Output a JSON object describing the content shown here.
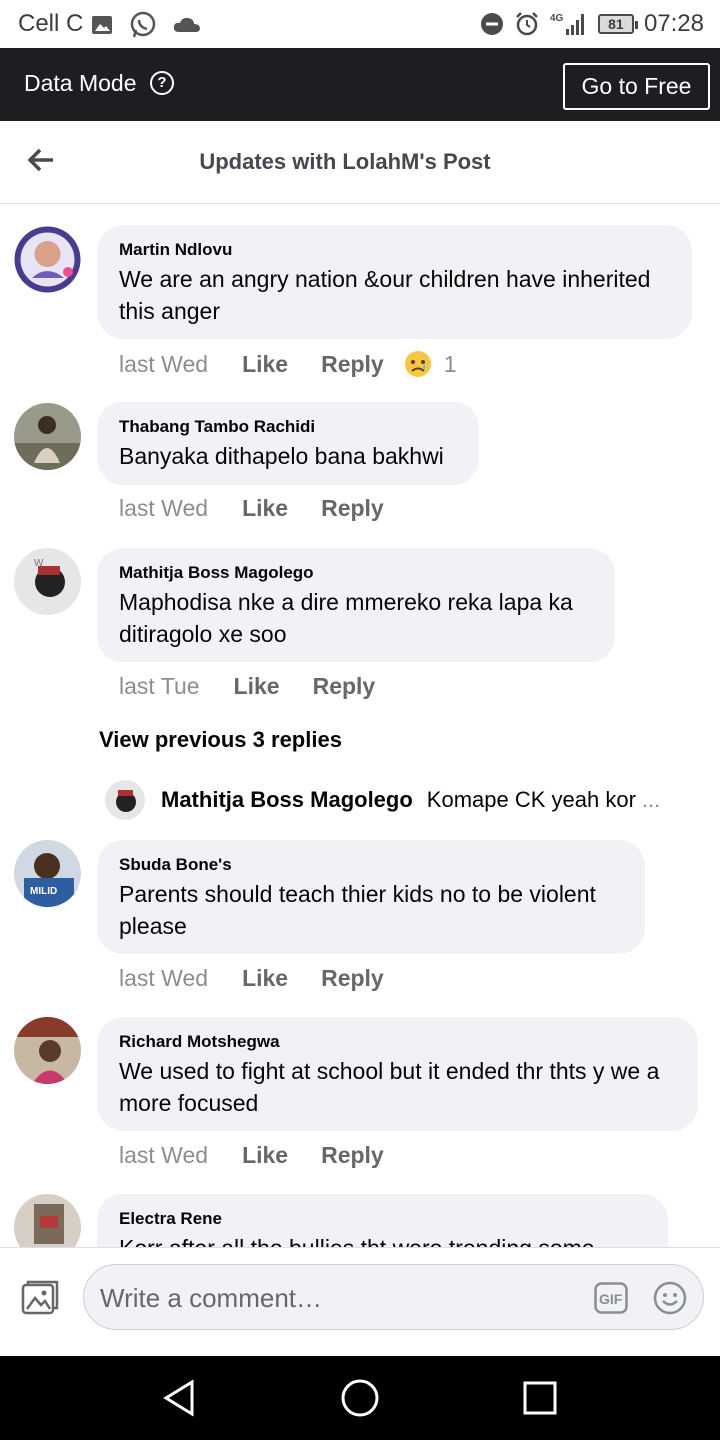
{
  "status_bar": {
    "carrier": "Cell C",
    "network": "4G",
    "battery": "81",
    "time": "07:28"
  },
  "data_mode": {
    "label": "Data Mode",
    "help_icon": "?",
    "button": "Go to Free"
  },
  "header": {
    "title": "Updates with LolahM's Post"
  },
  "comments": [
    {
      "author": "Martin Ndlovu",
      "text": "We are an angry nation &our children have inherited this anger",
      "time": "last Wed",
      "like": "Like",
      "reply": "Reply",
      "reaction_count": "1",
      "reaction": "sad-face"
    },
    {
      "author": "Thabang Tambo Rachidi",
      "text": "Banyaka dithapelo bana bakhwi",
      "time": "last Wed",
      "like": "Like",
      "reply": "Reply"
    },
    {
      "author": "Mathitja Boss Magolego",
      "text": "Maphodisa nke a dire mmereko reka lapa ka ditiragolo xe soo",
      "time": "last Tue",
      "like": "Like",
      "reply": "Reply"
    },
    {
      "author": "Sbuda Bone's",
      "text": "Parents should teach thier kids no to be violent please",
      "time": "last Wed",
      "like": "Like",
      "reply": "Reply"
    },
    {
      "author": "Richard Motshegwa",
      "text": "We used to fight at school but it ended thr thts y we a more focused",
      "time": "last Wed",
      "like": "Like",
      "reply": "Reply"
    },
    {
      "author": "Electra Rene",
      "text": "Korr after all the bullies tht were trending some"
    }
  ],
  "replies": {
    "view_previous": "View previous 3 replies",
    "preview_author": "Mathitja Boss Magolego",
    "preview_text": "Komape CK yeah kor",
    "preview_ellipsis": "..."
  },
  "composer": {
    "placeholder": "Write a comment…",
    "gif_label": "GIF"
  }
}
